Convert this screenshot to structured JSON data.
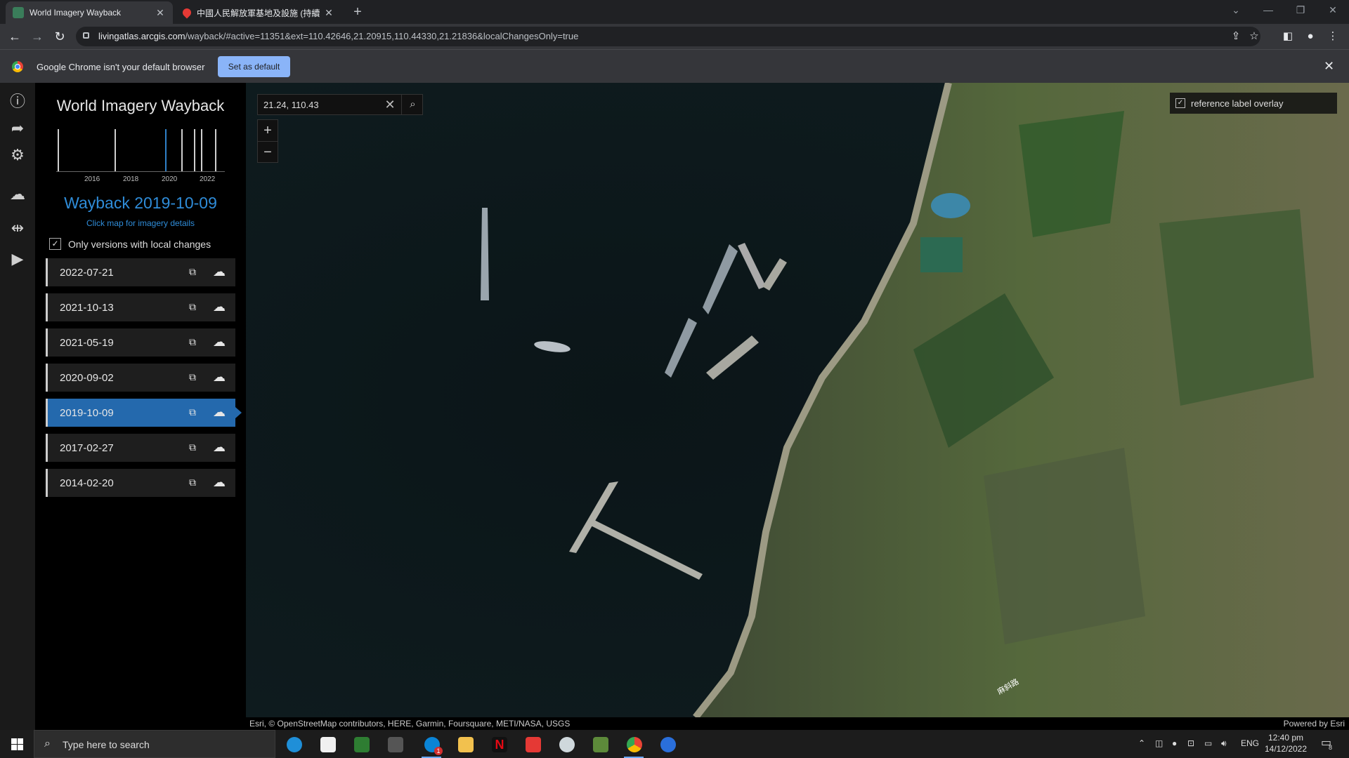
{
  "browser": {
    "tabs": [
      {
        "title": "World Imagery Wayback",
        "active": true
      },
      {
        "title": "中國人民解放軍基地及設施 (持續",
        "active": false
      }
    ],
    "url_domain": "livingatlas.arcgis.com",
    "url_path": "/wayback/#active=11351&ext=110.42646,21.20915,110.44330,21.21836&localChangesOnly=true",
    "infobar_message": "Google Chrome isn't your default browser",
    "infobar_button": "Set as default"
  },
  "app": {
    "title": "World Imagery Wayback",
    "timeline_years": [
      "2016",
      "2018",
      "2020",
      "2022"
    ],
    "release_title": "Wayback 2019-10-09",
    "click_hint": "Click map for imagery details",
    "local_changes_label": "Only versions with local changes",
    "local_changes_checked": true,
    "versions": [
      {
        "date": "2022-07-21",
        "selected": false
      },
      {
        "date": "2021-10-13",
        "selected": false
      },
      {
        "date": "2021-05-19",
        "selected": false
      },
      {
        "date": "2020-09-02",
        "selected": false
      },
      {
        "date": "2019-10-09",
        "selected": true
      },
      {
        "date": "2017-02-27",
        "selected": false
      },
      {
        "date": "2014-02-20",
        "selected": false
      }
    ]
  },
  "map": {
    "search_value": "21.24, 110.43",
    "overlay_label": "reference label overlay",
    "overlay_checked": true,
    "attribution": "Esri, © OpenStreetMap contributors, HERE, Garmin, Foursquare, METI/NASA, USGS",
    "powered_by": "Powered by Esri",
    "road_label": "麻斜路"
  },
  "taskbar": {
    "search_placeholder": "Type here to search",
    "language": "ENG",
    "time": "12:40 pm",
    "date": "14/12/2022",
    "notification_count": "8",
    "skype_badge": "1"
  },
  "colors": {
    "accent_blue": "#2f8cd8",
    "selected_row": "#2469ad",
    "water": "#0c1618"
  }
}
